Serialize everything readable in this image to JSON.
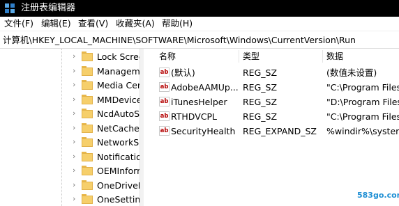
{
  "window": {
    "title": "注册表编辑器"
  },
  "menu": [
    "文件(F)",
    "编辑(E)",
    "查看(V)",
    "收藏夹(A)",
    "帮助(H)"
  ],
  "address": "计算机\\HKEY_LOCAL_MACHINE\\SOFTWARE\\Microsoft\\Windows\\CurrentVersion\\Run",
  "tree": [
    "Lock Scree",
    "Managem",
    "Media Cer",
    "MMDevice",
    "NcdAutoS",
    "NetCache",
    "NetworkS",
    "Notificatio",
    "OEMInforr",
    "OneDriveR",
    "OneSetting"
  ],
  "columns": {
    "name": "名称",
    "type": "类型",
    "data": "数据"
  },
  "values": [
    {
      "icon": "ab",
      "name": "(默认)",
      "type": "REG_SZ",
      "data": "(数值未设置)"
    },
    {
      "icon": "ab",
      "name": "AdobeAAMUp...",
      "type": "REG_SZ",
      "data": "\"C:\\Program Files"
    },
    {
      "icon": "ab",
      "name": "iTunesHelper",
      "type": "REG_SZ",
      "data": "\"D:\\Program Files"
    },
    {
      "icon": "ab",
      "name": "RTHDVCPL",
      "type": "REG_SZ",
      "data": "\"C:\\Program Files"
    },
    {
      "icon": "ab",
      "name": "SecurityHealth",
      "type": "REG_EXPAND_SZ",
      "data": "%windir%\\system"
    }
  ],
  "watermark": "583go.com",
  "colors": {
    "titlebar": "#000000",
    "folder": "#f6cf6b",
    "reg_icon": "#b40000"
  }
}
